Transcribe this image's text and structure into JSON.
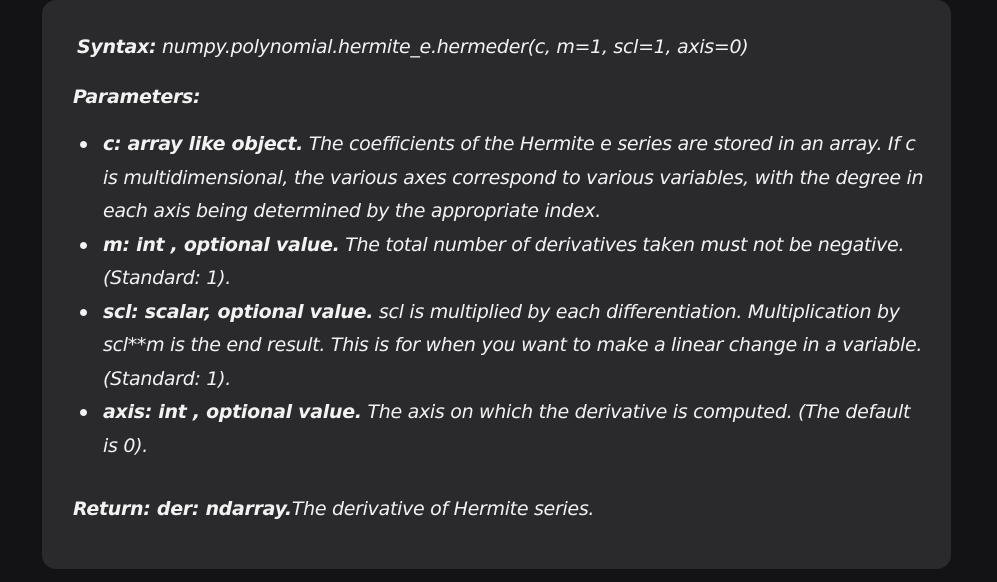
{
  "syntax": {
    "label": "Syntax:",
    "code": " numpy.polynomial.hermite_e.hermeder(c, m=1, scl=1, axis=0)"
  },
  "parameters": {
    "title": "Parameters:",
    "items": [
      {
        "term": "c: array like object.",
        "desc": " The coefficients of the Hermite e series are stored in an array. If c is multidimensional, the various axes correspond to various variables, with the degree in each axis being determined by the appropriate index."
      },
      {
        "term": "m: int , optional value.",
        "desc": " The total number of derivatives taken must not be negative. (Standard: 1)."
      },
      {
        "term": "scl: scalar, optional value.",
        "desc": " scl is multiplied by each differentiation. Multiplication by scl**m is the end result. This is for when you want to make a linear change in a variable. (Standard: 1)."
      },
      {
        "term": "axis: int , optional value.",
        "desc": " The axis on which the derivative is computed. (The default is 0)."
      }
    ]
  },
  "return": {
    "label": "Return: der: ndarray.",
    "text": "The derivative of Hermite series."
  }
}
